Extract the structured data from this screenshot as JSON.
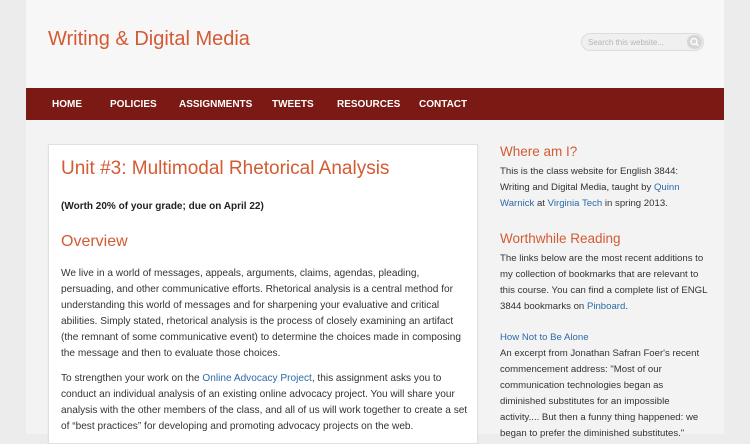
{
  "site": {
    "title": "Writing & Digital Media"
  },
  "search": {
    "placeholder": "Search this website..."
  },
  "nav": {
    "items": [
      "HOME",
      "POLICIES",
      "ASSIGNMENTS",
      "TWEETS",
      "RESOURCES",
      "CONTACT"
    ]
  },
  "main": {
    "title": "Unit #3: Multimodal Rhetorical Analysis",
    "worth": "(Worth 20% of your grade; due on April 22)",
    "overview_heading": "Overview",
    "para1": "We live in a world of messages, appeals, arguments, claims, agendas, pleading, persuading, and other communicative efforts. Rhetorical analysis is a central method for understanding this world of messages and for sharpening your evaluative and critical abilities. Simply stated, rhetorical analysis is the process of closely examining an artifact (the remnant of some communicative event) to determine the choices made in composing the message and then to evaluate those choices.",
    "para2_before": "To strengthen your work on the ",
    "para2_link": "Online Advocacy Project",
    "para2_after": ", this assignment asks you to conduct an individual analysis of an existing online advocacy project. You will share your analysis with the other members of the class, and all of us will work together to create a set of “best practices” for developing and promoting advocacy projects on the web."
  },
  "sidebar": {
    "where_heading": "Where am I?",
    "where_text_1": "This is the class website for English 3844: Writing and Digital Media, taught by ",
    "where_link_1": "Quinn Warnick",
    "where_text_2": " at ",
    "where_link_2": "Virginia Tech",
    "where_text_3": " in spring 2013.",
    "reading_heading": "Worthwhile Reading",
    "reading_text_1": "The links below are the most recent additions to my collection of bookmarks that are relevant to this course. You can find a complete list of ENGL 3844 bookmarks on ",
    "reading_link": "Pinboard",
    "reading_text_2": ".",
    "bookmark_title": "How Not to Be Alone",
    "bookmark_text": "An excerpt from Jonathan Safran Foer's recent commencement address: \"Most of our communication technologies began as diminished substitutes for an impossible activity.... But then a funny thing happened: we began to prefer the diminished substitutes.\""
  },
  "colors": {
    "accent": "#d35b33",
    "nav_bg": "#7b1a14",
    "link": "#2b6aa8"
  }
}
